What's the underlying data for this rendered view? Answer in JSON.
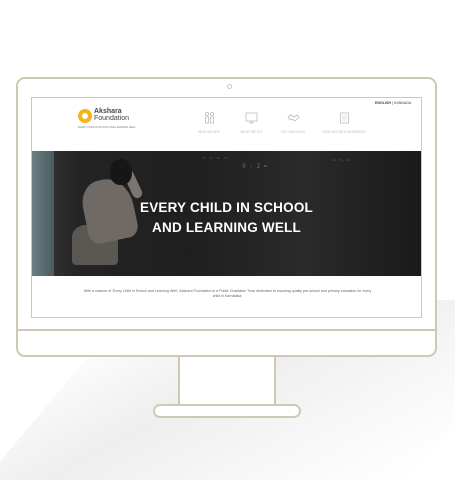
{
  "logo": {
    "name_line1": "Akshara",
    "name_line2": "Foundation",
    "tagline": "EVERY CHILD IN SCHOOL AND LEARNING WELL"
  },
  "lang_switch": {
    "active": "ENGLISH",
    "separator": " | ",
    "other": "KANNADA"
  },
  "nav": [
    {
      "label": "WHO WE ARE",
      "icon": "people-icon"
    },
    {
      "label": "WHAT WE DO",
      "icon": "screen-icon"
    },
    {
      "label": "GET INVOLVED",
      "icon": "handshake-icon"
    },
    {
      "label": "RESOURCES & RESEARCH",
      "icon": "document-icon"
    }
  ],
  "hero": {
    "title_line1": "EVERY CHILD IN SCHOOL",
    "title_line2": "AND LEARNING WELL"
  },
  "mission": "With a mission of 'Every Child in School and Learning Well', Akshara Foundation is a Public Charitable Trust dedicated to ensuring quality pre-school and primary education for every child in Karnataka.",
  "colors": {
    "brand_yellow": "#f2b51c",
    "frame": "#cfc8b4"
  }
}
